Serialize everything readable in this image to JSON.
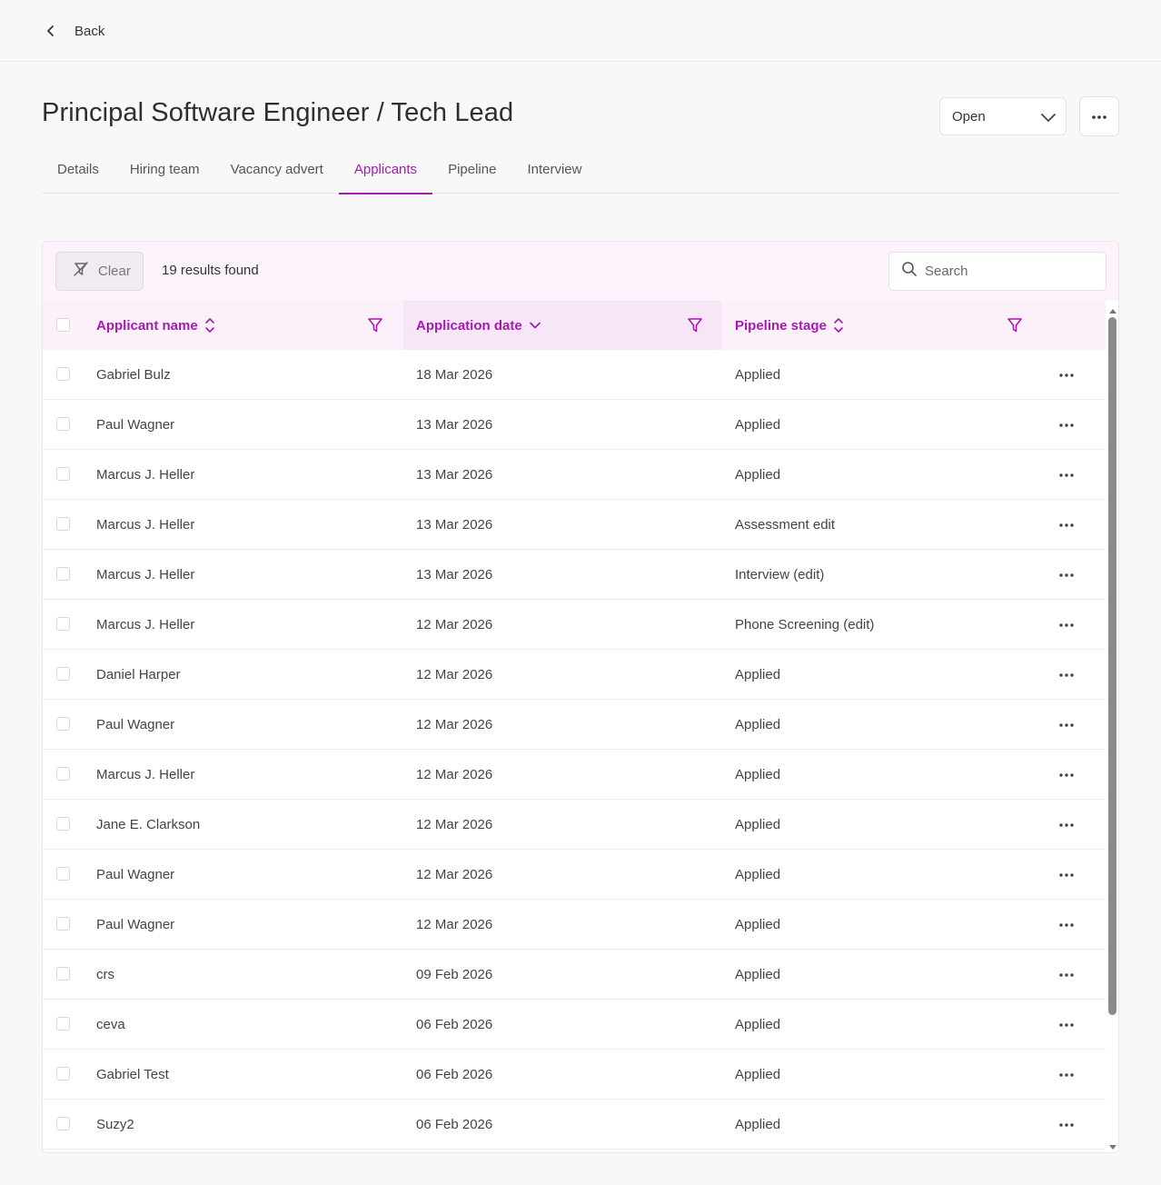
{
  "nav": {
    "back_label": "Back"
  },
  "header": {
    "title": "Principal Software Engineer / Tech Lead",
    "status": "Open"
  },
  "tabs": [
    {
      "label": "Details"
    },
    {
      "label": "Hiring team"
    },
    {
      "label": "Vacancy advert"
    },
    {
      "label": "Applicants",
      "active": true
    },
    {
      "label": "Pipeline"
    },
    {
      "label": "Interview"
    }
  ],
  "toolbar": {
    "clear_label": "Clear",
    "results_text": "19 results found",
    "search_placeholder": "Search"
  },
  "table": {
    "columns": [
      {
        "label": "Applicant name",
        "sort": "sortable"
      },
      {
        "label": "Application date",
        "sort": "descending"
      },
      {
        "label": "Pipeline stage",
        "sort": "sortable"
      }
    ],
    "rows": [
      {
        "name": "Gabriel Bulz",
        "date": "18 Mar 2026",
        "stage": "Applied"
      },
      {
        "name": "Paul Wagner",
        "date": "13 Mar 2026",
        "stage": "Applied"
      },
      {
        "name": "Marcus J. Heller",
        "date": "13 Mar 2026",
        "stage": "Applied"
      },
      {
        "name": "Marcus J. Heller",
        "date": "13 Mar 2026",
        "stage": "Assessment edit"
      },
      {
        "name": "Marcus J. Heller",
        "date": "13 Mar 2026",
        "stage": "Interview (edit)"
      },
      {
        "name": "Marcus J. Heller",
        "date": "12 Mar 2026",
        "stage": "Phone Screening (edit)"
      },
      {
        "name": "Daniel Harper",
        "date": "12 Mar 2026",
        "stage": "Applied"
      },
      {
        "name": "Paul Wagner",
        "date": "12 Mar 2026",
        "stage": "Applied"
      },
      {
        "name": "Marcus J. Heller",
        "date": "12 Mar 2026",
        "stage": "Applied"
      },
      {
        "name": "Jane E. Clarkson",
        "date": "12 Mar 2026",
        "stage": "Applied"
      },
      {
        "name": "Paul Wagner",
        "date": "12 Mar 2026",
        "stage": "Applied"
      },
      {
        "name": "Paul Wagner",
        "date": "12 Mar 2026",
        "stage": "Applied"
      },
      {
        "name": "crs",
        "date": "09 Feb 2026",
        "stage": "Applied"
      },
      {
        "name": "ceva",
        "date": "06 Feb 2026",
        "stage": "Applied"
      },
      {
        "name": "Gabriel Test",
        "date": "06 Feb 2026",
        "stage": "Applied"
      },
      {
        "name": "Suzy2",
        "date": "06 Feb 2026",
        "stage": "Applied"
      }
    ]
  },
  "icons": {
    "back": "chevron-left-icon",
    "status_dropdown": "chevron-down-icon",
    "more": "more-horizontal-icon",
    "clear": "filter-off-icon",
    "search": "search-icon",
    "filter": "filter-icon",
    "sort": "sort-icon"
  },
  "colors": {
    "accent": "#a21caf",
    "header_bg": "#fcf0fb",
    "sorted_header_bg": "#f7e6f6",
    "page_bg": "#f8f8f8"
  }
}
